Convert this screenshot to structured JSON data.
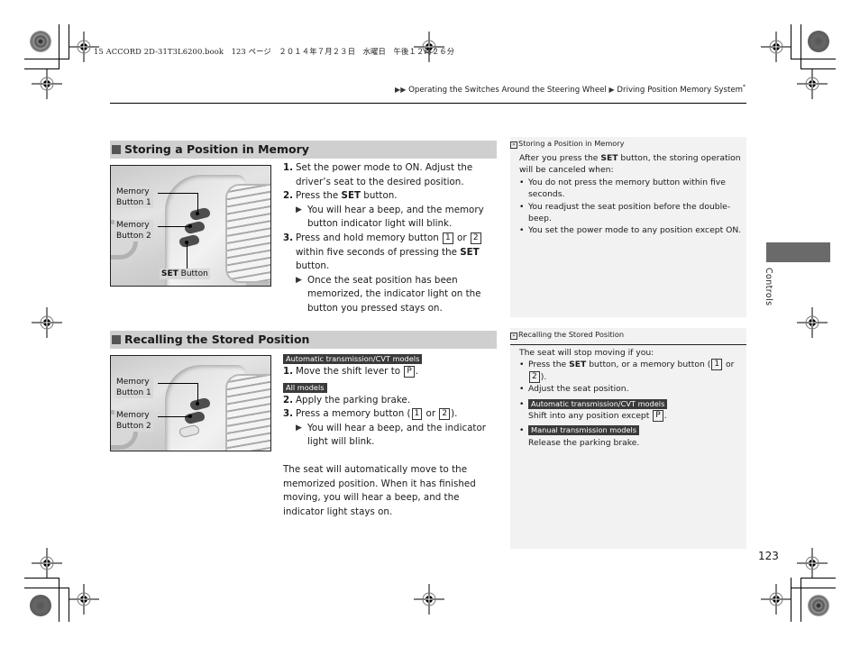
{
  "print_header": "15 ACCORD 2D-31T3L6200.book　123 ページ　２０１４年７月２３日　水曜日　午後１２時２６分",
  "breadcrumb": {
    "prefix_icon": "double-triangle-icon",
    "section": "Operating the Switches Around the Steering Wheel",
    "separator_icon": "triangle-icon",
    "page": "Driving Position Memory System",
    "asterisk": "*"
  },
  "storing": {
    "heading": "Storing a Position in Memory",
    "figure": {
      "callouts": [
        "Memory",
        "Button 1",
        "Memory",
        "Button 2"
      ],
      "set_label_bold": "SET",
      "set_label_rest": " Button"
    },
    "steps": [
      {
        "num": "1.",
        "text": "Set the power mode to ON. Adjust the driver’s seat to the desired position."
      },
      {
        "num": "2.",
        "pre": "Press the ",
        "bold": "SET",
        "post": " button.",
        "result": "You will hear a beep, and the memory button indicator light will blink."
      },
      {
        "num": "3.",
        "pre": "Press and hold memory button ",
        "key1": "1",
        "mid": " or ",
        "key2": "2",
        "post": " within five seconds of pressing the ",
        "bold": "SET",
        "end": " button.",
        "result": "Once the seat position has been memorized, the indicator light on the button you pressed stays on."
      }
    ],
    "sidebar": {
      "title": "Storing a Position in Memory",
      "intro_pre": "After you press the ",
      "intro_bold": "SET",
      "intro_post": " button, the storing operation will be canceled when:",
      "bullets": [
        "You do not press the memory button within five seconds.",
        "You readjust the seat position before the double-beep.",
        "You set the power mode to any position except ON."
      ]
    }
  },
  "recalling": {
    "heading": "Recalling the Stored Position",
    "figure": {
      "callouts": [
        "Memory",
        "Button 1",
        "Memory",
        "Button 2"
      ]
    },
    "tag_auto": "Automatic transmission/CVT models",
    "step1": {
      "num": "1.",
      "text": "Move the shift lever to ",
      "key": "P",
      "end": "."
    },
    "tag_all": "All models",
    "step2": {
      "num": "2.",
      "text": "Apply the parking brake."
    },
    "step3": {
      "num": "3.",
      "pre": "Press a memory button (",
      "key1": "1",
      "mid": " or ",
      "key2": "2",
      "post": ").",
      "result": "You will hear a beep, and the indicator light will blink."
    },
    "paragraph": "The seat will automatically move to the memorized position. When it has finished moving, you will hear a beep, and the indicator light stays on.",
    "sidebar": {
      "title": "Recalling the Stored Position",
      "intro": "The seat will stop moving if you:",
      "b1_pre": "Press the ",
      "b1_bold": "SET",
      "b1_mid": " button, or a memory button (",
      "b1_key1": "1",
      "b1_or": " or ",
      "b1_key2": "2",
      "b1_end": ").",
      "b2": "Adjust the seat position.",
      "b3_tag": "Automatic transmission/CVT models",
      "b3_text": "Shift into any position except ",
      "b3_key": "P",
      "b3_end": ".",
      "b4_tag": "Manual transmission models",
      "b4_text": "Release the parking brake."
    }
  },
  "side_tab": "Controls",
  "page_number": "123",
  "colors": {
    "section_header_bg": "#cfcfcf",
    "sidebar_bg": "#f2f2f2",
    "tag_bg": "#3a3a3a",
    "side_tab_block": "#6a6a6a"
  }
}
